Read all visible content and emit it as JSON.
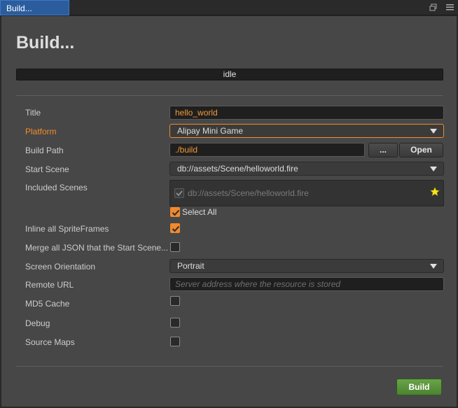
{
  "tab": {
    "title": "Build..."
  },
  "heading": "Build...",
  "status": "idle",
  "form": {
    "title": {
      "label": "Title",
      "value": "hello_world"
    },
    "platform": {
      "label": "Platform",
      "value": "Alipay Mini Game"
    },
    "build_path": {
      "label": "Build Path",
      "value": "./build",
      "browse_label": "...",
      "open_label": "Open"
    },
    "start_scene": {
      "label": "Start Scene",
      "value": "db://assets/Scene/helloworld.fire"
    },
    "included_scenes": {
      "label": "Included Scenes",
      "items": [
        "db://assets/Scene/helloworld.fire"
      ],
      "select_all_label": "Select All",
      "select_all": true
    },
    "inline_spriteframes": {
      "label": "Inline all SpriteFrames",
      "checked": true
    },
    "merge_json": {
      "label": "Merge all JSON that the Start Scene...",
      "checked": false
    },
    "screen_orientation": {
      "label": "Screen Orientation",
      "value": "Portrait"
    },
    "remote_url": {
      "label": "Remote URL",
      "value": "",
      "placeholder": "Server address where the resource is stored"
    },
    "md5_cache": {
      "label": "MD5 Cache",
      "checked": false
    },
    "debug": {
      "label": "Debug",
      "checked": false
    },
    "source_maps": {
      "label": "Source Maps",
      "checked": false
    }
  },
  "build_button": "Build",
  "colors": {
    "accent": "#ef8a2f",
    "tab_active": "#2b5d9e",
    "build_button": "#5a9a3c",
    "panel": "#474747"
  }
}
